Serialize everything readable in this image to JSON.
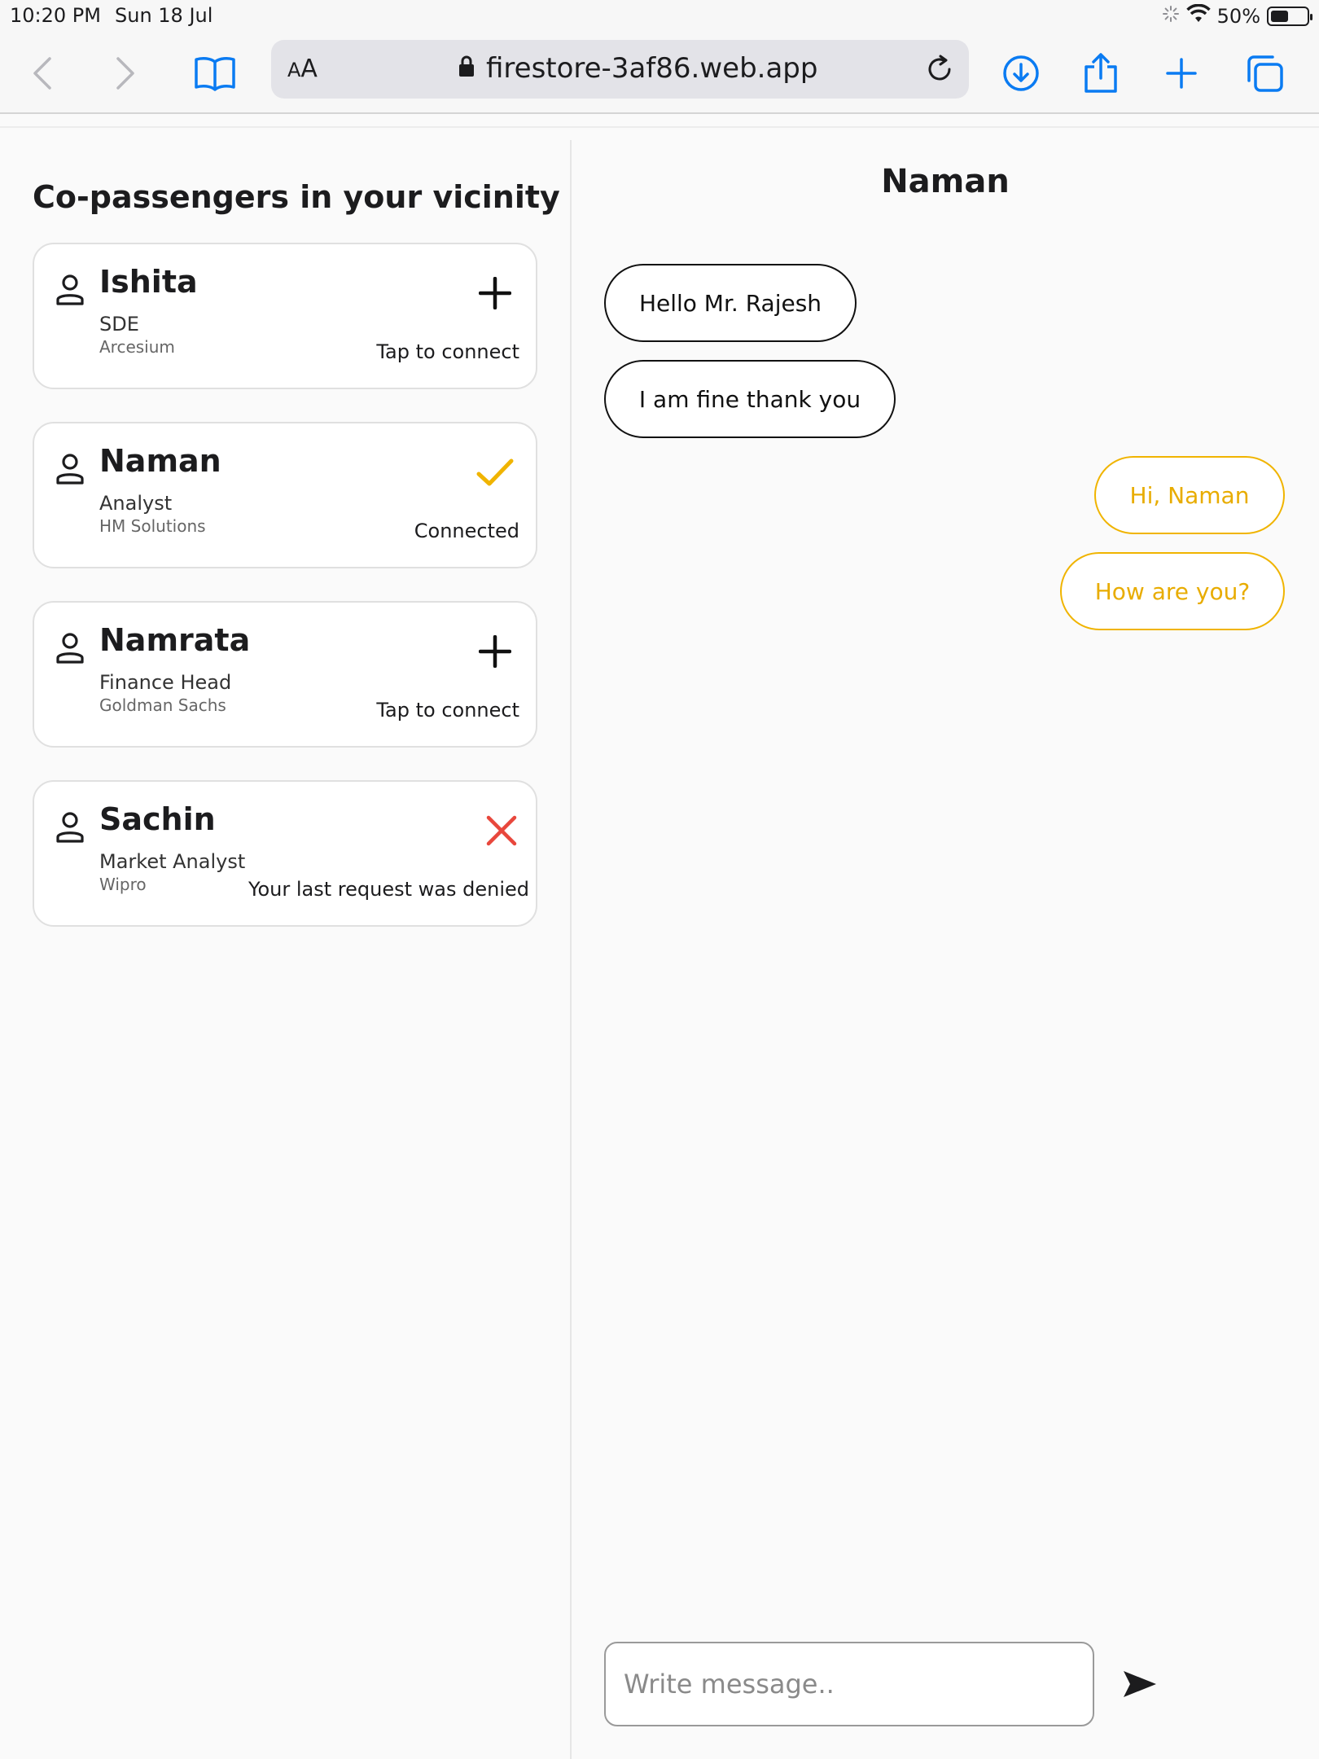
{
  "status_bar": {
    "time": "10:20 PM",
    "date": "Sun 18 Jul",
    "battery_text": "50%",
    "battery_level": 0.5
  },
  "browser": {
    "text_size_label_big": "A",
    "text_size_label_small": "A",
    "url": "firestore-3af86.web.app",
    "accent_color": "#0a7bf2"
  },
  "left_panel": {
    "title": "Co-passengers in your vicinity",
    "passengers": [
      {
        "name": "Ishita",
        "role": "SDE",
        "company": "Arcesium",
        "status": "Tap to connect",
        "action_icon": "plus-icon"
      },
      {
        "name": "Naman",
        "role": "Analyst",
        "company": "HM Solutions",
        "status": "Connected",
        "action_icon": "check-icon"
      },
      {
        "name": "Namrata",
        "role": "Finance Head",
        "company": "Goldman Sachs",
        "status": "Tap to connect",
        "action_icon": "plus-icon"
      },
      {
        "name": "Sachin",
        "role": "Market Analyst",
        "company": "Wipro",
        "status": "Your last request was denied",
        "action_icon": "cross-icon"
      }
    ]
  },
  "chat": {
    "title": "Naman",
    "messages": [
      {
        "text": "Hello Mr. Rajesh",
        "direction": "incoming"
      },
      {
        "text": "I am fine thank you",
        "direction": "incoming"
      },
      {
        "text": "Hi, Naman",
        "direction": "outgoing"
      },
      {
        "text": "How are you?",
        "direction": "outgoing"
      }
    ],
    "input_placeholder": "Write message..",
    "outgoing_color": "#f0b400",
    "denied_color": "#e8473c"
  }
}
